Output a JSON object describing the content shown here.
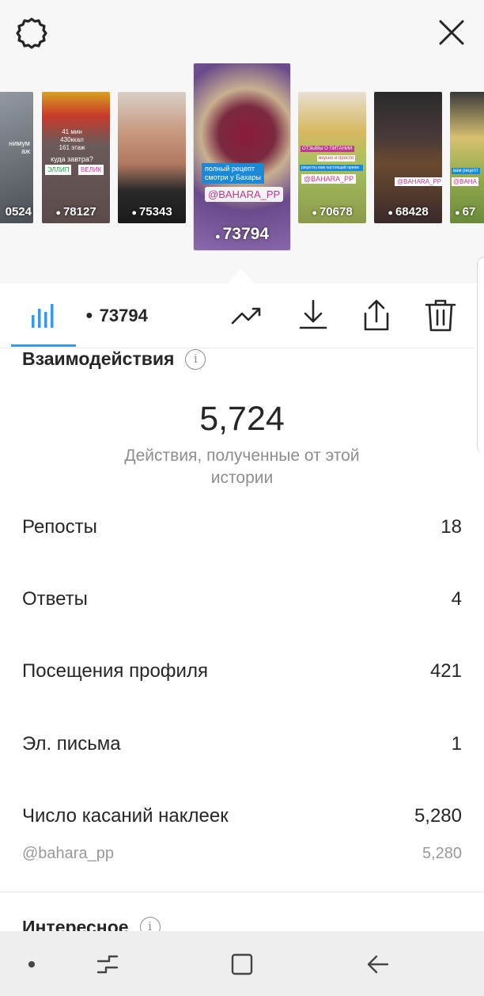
{
  "header": {
    "settings_icon": "gear-icon",
    "close_icon": "close-icon"
  },
  "stories": [
    {
      "count": "0524",
      "bg": "#6b7078",
      "overlay": [
        "нимум",
        "аж"
      ]
    },
    {
      "count": "78127",
      "bg": "#c94a2a",
      "overlay": [
        "41 мин",
        "430ккал",
        "161 этаж",
        "куда завтра?",
        "ЭЛЛИП",
        "ВЕЛИК"
      ]
    },
    {
      "count": "75343",
      "bg": "#8a5a4a",
      "overlay": []
    },
    {
      "count": "73794",
      "bg": "#7d3a5a",
      "overlay": [
        "полный рецепт",
        "смотри у Бахары",
        "@BAHARA_PP"
      ]
    },
    {
      "count": "70678",
      "bg": "#c8a84a",
      "overlay": [
        "ОТЗЫВЫ О ПИТАНИИ",
        "вкусно и просто",
        "рецепты вам настоящий прием",
        "@BAHARA_PP"
      ]
    },
    {
      "count": "68428",
      "bg": "#5a4a40",
      "overlay": [
        "@BAHARA_PP"
      ]
    },
    {
      "count": "67",
      "bg": "#a89a6a",
      "overlay": [
        "вам рецепт",
        "@BAHA"
      ]
    }
  ],
  "toolbar": {
    "views": "73794",
    "stats_icon": "bar-chart-icon",
    "trend_icon": "trend-up-icon",
    "download_icon": "download-icon",
    "share_icon": "share-icon",
    "delete_icon": "trash-icon"
  },
  "interactions": {
    "title": "Взаимодействия",
    "info": "i",
    "total": "5,724",
    "total_caption": "Действия, полученные от этой истории",
    "rows": [
      {
        "label": "Репосты",
        "value": "18"
      },
      {
        "label": "Ответы",
        "value": "4"
      },
      {
        "label": "Посещения профиля",
        "value": "421"
      },
      {
        "label": "Эл. письма",
        "value": "1"
      },
      {
        "label": "Число касаний наклеек",
        "value": "5,280"
      }
    ],
    "sticker_sub": {
      "label": "@bahara_pp",
      "value": "5,280"
    }
  },
  "next_section": {
    "title": "Интересное",
    "info": "i"
  },
  "navbar": {
    "dot_icon": "dot-icon",
    "recents_icon": "recents-icon",
    "home_icon": "home-icon",
    "back_icon": "back-icon"
  }
}
